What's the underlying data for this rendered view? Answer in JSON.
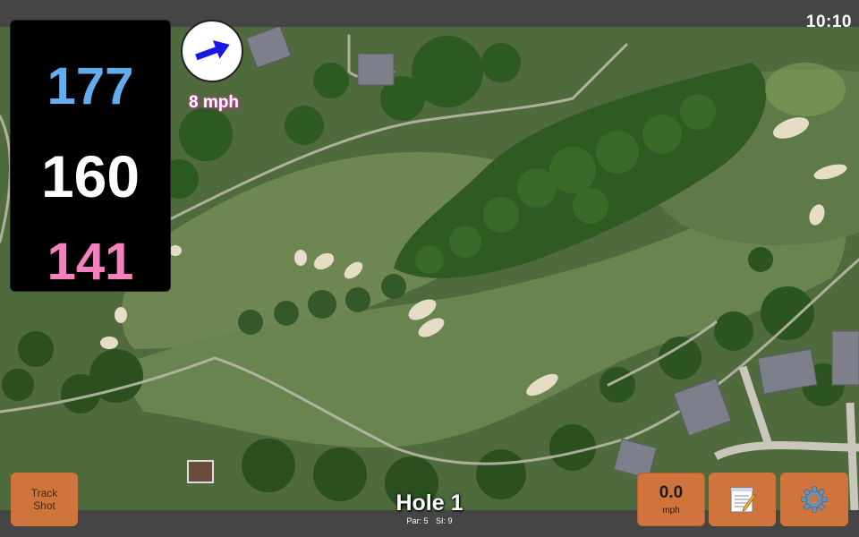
{
  "status": {
    "time": "10:10"
  },
  "distances": {
    "back": "177",
    "center": "160",
    "front": "141"
  },
  "wind": {
    "speed_label": "8 mph",
    "icon": "wind-direction-arrow-icon"
  },
  "hole": {
    "title": "Hole 1",
    "par_label": "Par: 5",
    "si_label": "SI: 9"
  },
  "buttons": {
    "track_shot_line1": "Track",
    "track_shot_line2": "Shot",
    "speed_value": "0.0",
    "speed_unit": "mph",
    "notes_icon": "notepad-icon",
    "settings_icon": "gear-icon"
  },
  "colors": {
    "back_distance": "#62acef",
    "center_distance": "#ffffff",
    "front_distance": "#f480be",
    "button_orange": "#d0743e"
  }
}
